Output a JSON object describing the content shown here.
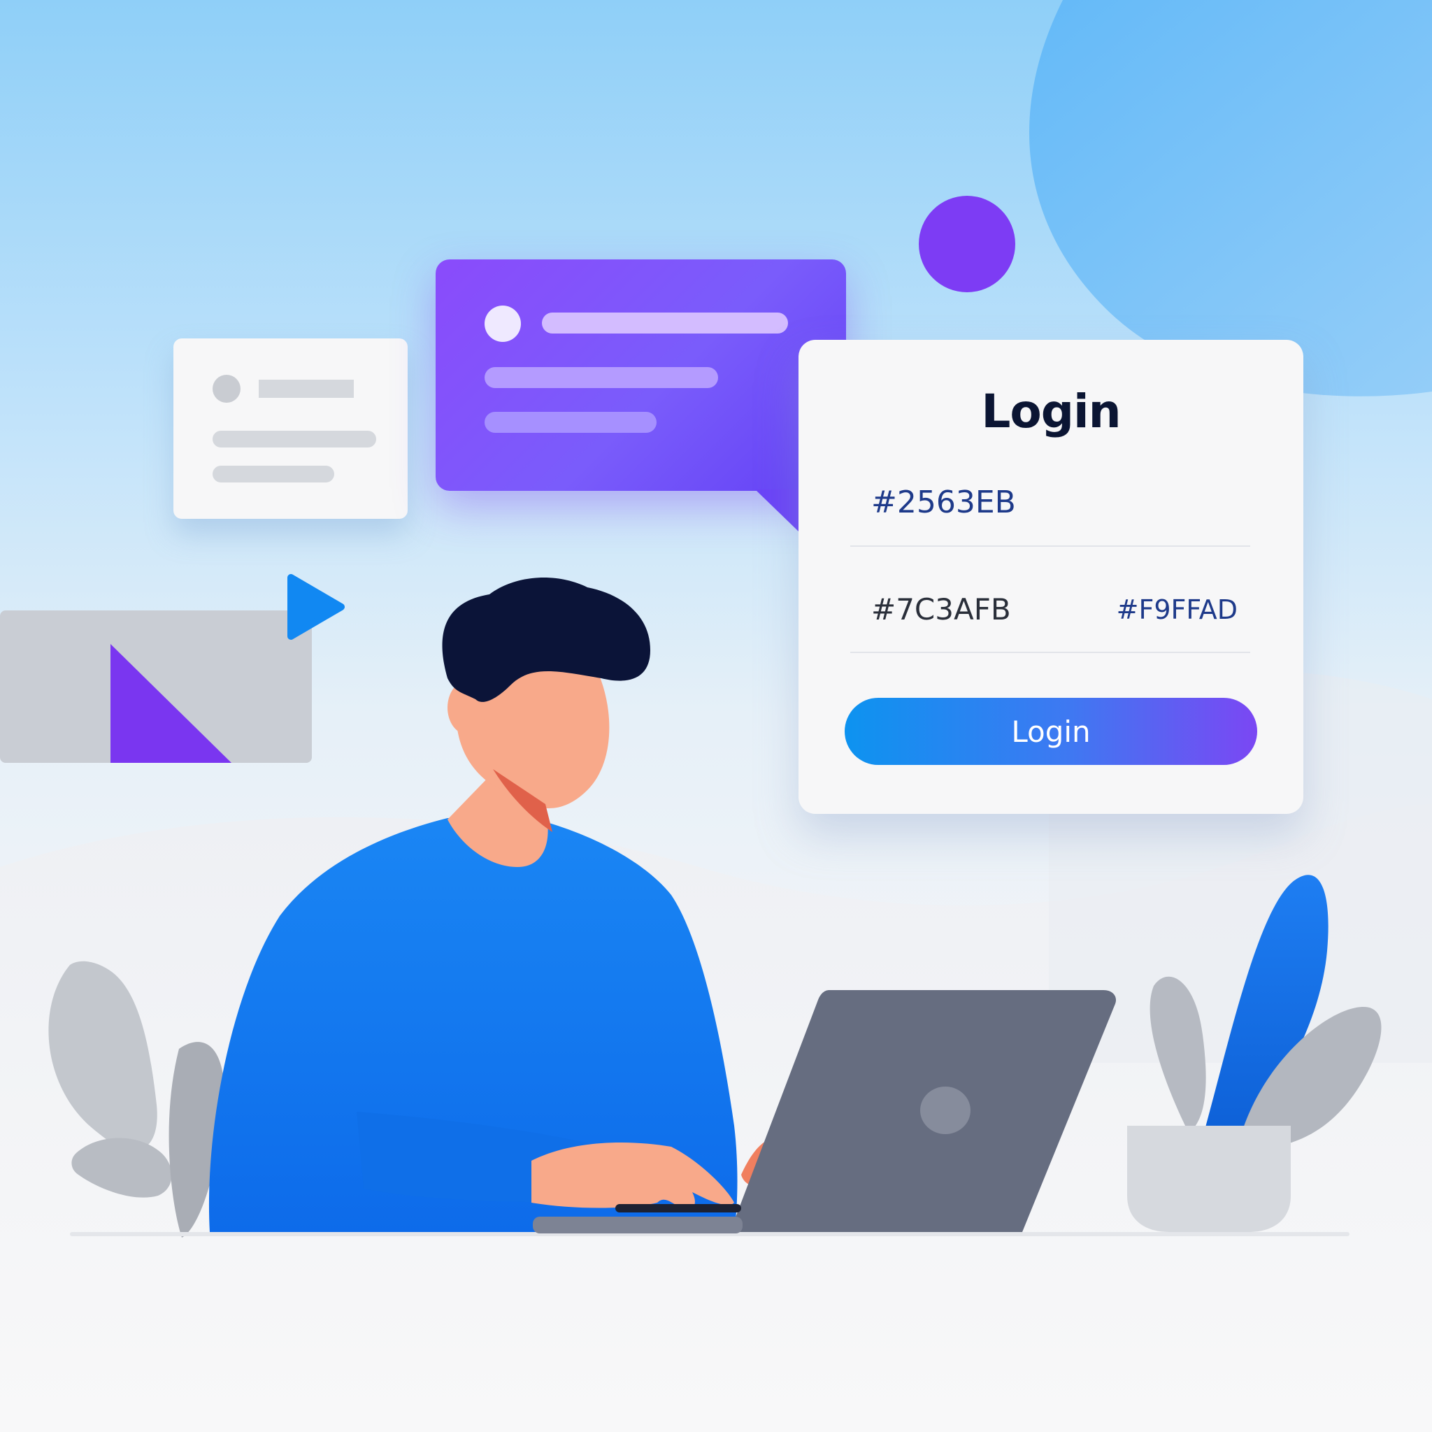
{
  "login_card": {
    "title": "Login",
    "field_primary_value": "#2563EB",
    "field_secondary_value": "#7C3AFB",
    "field_secondary_extra": "#F9FFAD",
    "button_label": "Login"
  },
  "colors": {
    "brand_blue": "#2563EB",
    "brand_purple": "#7C3AED",
    "sweater_blue": "#1877F2",
    "laptop_gray": "#666D80",
    "plant_gray": "#B6BAC2",
    "skin": "#F8A98A",
    "hair": "#0B1438"
  },
  "icons": {
    "play": "play-icon",
    "avatar_dot": "avatar-placeholder-icon",
    "laptop_logo": "laptop-logo-icon"
  }
}
